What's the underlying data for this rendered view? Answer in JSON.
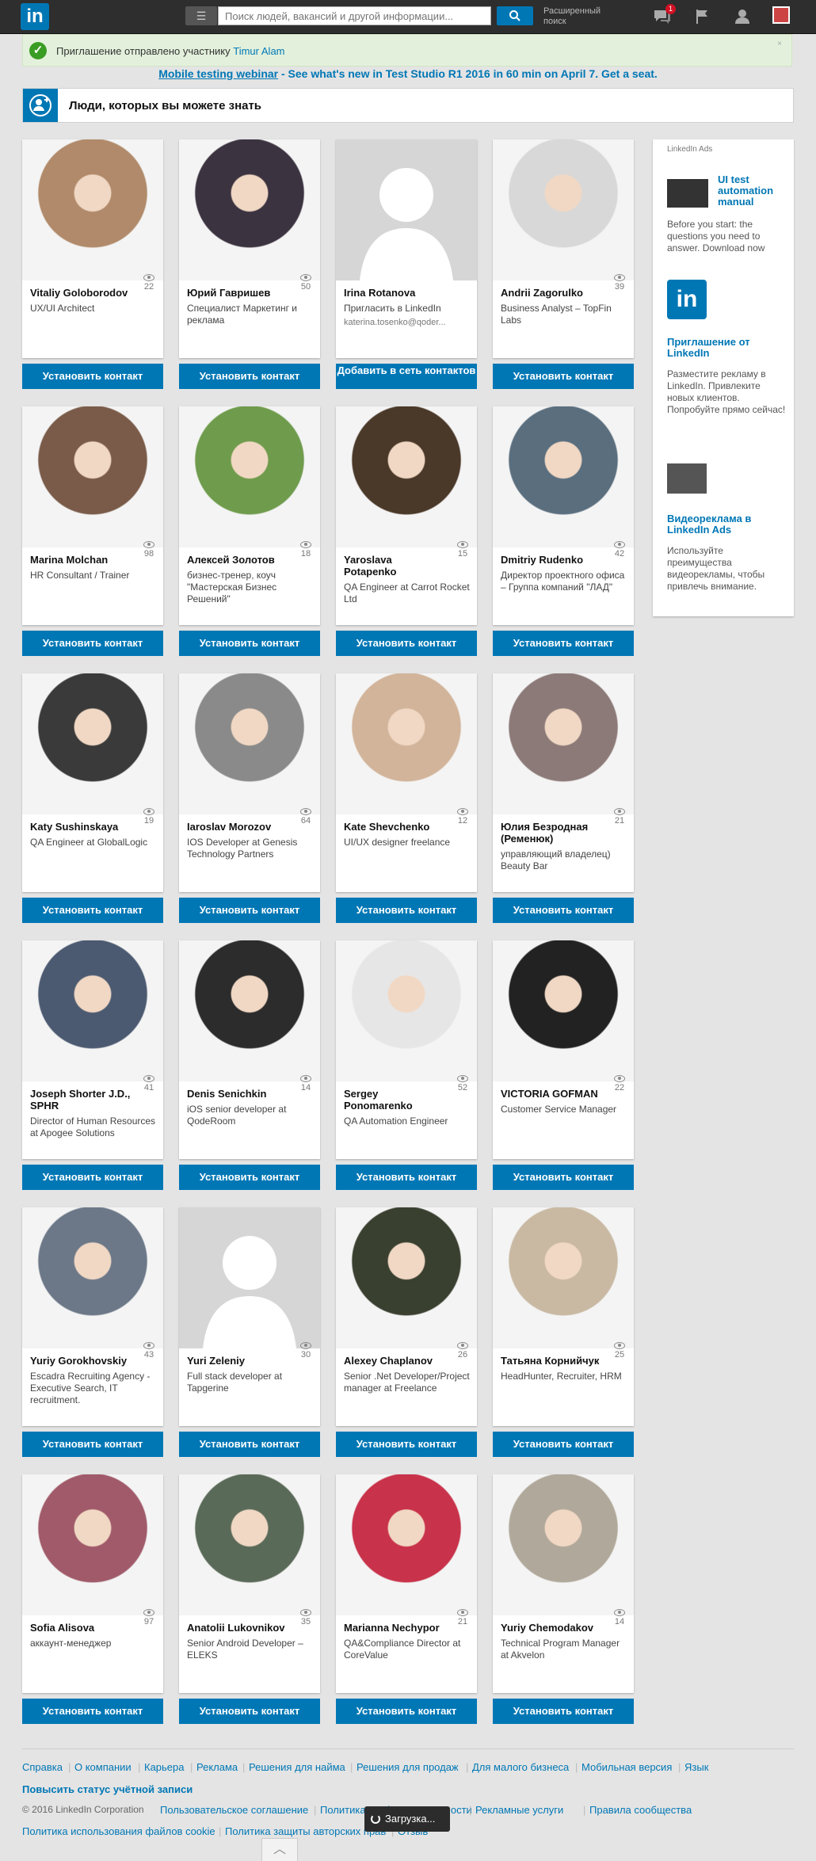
{
  "topbar": {
    "logo": "in",
    "search_placeholder": "Поиск людей, вакансий и другой информации...",
    "advanced_search": "Расширенный поиск",
    "messages_badge": "1"
  },
  "notice": {
    "text": "Приглашение отправлено участнику",
    "name": "Timur Alam",
    "close": "×"
  },
  "webinar": {
    "strong": "Mobile testing webinar",
    "rest": " - See what's new in Test Studio R1 2016 in 60 min on April 7. Get a seat."
  },
  "pymk": {
    "title": "Люди, которых вы можете знать"
  },
  "people": [
    {
      "name": "Vitaliy Goloborodov",
      "title": "UX/UI Architect",
      "count": "22",
      "button": "Установить контакт",
      "photo": "#b08a6a"
    },
    {
      "name": "Юрий Гавришев",
      "title": "Специалист Маркетинг и реклама",
      "count": "50",
      "button": "Установить контакт",
      "photo": "#3b3340"
    },
    {
      "name": "Irina Rotanova",
      "title": "Пригласить в LinkedIn",
      "subtitle": "katerina.tosenko@qoder...",
      "count": "",
      "button": "Добавить в сеть контактов",
      "photo": "placeholder"
    },
    {
      "name": "Andrii Zagorulko",
      "title": "Business Analyst – TopFin Labs",
      "count": "39",
      "button": "Установить контакт",
      "photo": "#d8d8d8"
    },
    {
      "name": "Marina Molchan",
      "title": "HR Consultant / Trainer",
      "count": "98",
      "button": "Установить контакт",
      "photo": "#7a5b49"
    },
    {
      "name": "Алексей Золотов",
      "title": "бизнес-тренер, коуч \"Мастерская Бизнес Решений\"",
      "count": "18",
      "button": "Установить контакт",
      "photo": "#6f9b4c"
    },
    {
      "name": "Yaroslava Potapenko",
      "title": "QA Engineer at Carrot Rocket Ltd",
      "count": "15",
      "button": "Установить контакт",
      "photo": "#4a3828"
    },
    {
      "name": "Dmitriy Rudenko",
      "title": "Директор проектного офиса – Группа компаний \"ЛАД\"",
      "count": "42",
      "button": "Установить контакт",
      "photo": "#5a6e7e"
    },
    {
      "name": "Katy Sushinskaya",
      "title": "QA Engineer at GlobalLogic",
      "count": "19",
      "button": "Установить контакт",
      "photo": "#3a3a3a"
    },
    {
      "name": "Iaroslav Morozov",
      "title": "IOS Developer at Genesis Technology Partners",
      "count": "64",
      "button": "Установить контакт",
      "photo": "#8a8a8a"
    },
    {
      "name": "Kate Shevchenko",
      "title": "UI/UX designer freelance",
      "count": "12",
      "button": "Установить контакт",
      "photo": "#d2b49a"
    },
    {
      "name": "Юлия Безродная (Ременюк)",
      "title": "управляющий владелец) Beauty Bar",
      "count": "21",
      "button": "Установить контакт",
      "photo": "#8c7a78"
    },
    {
      "name": "Joseph Shorter J.D., SPHR",
      "title": "Director of Human Resources at Apogee Solutions",
      "count": "41",
      "button": "Установить контакт",
      "photo": "#4b5a70"
    },
    {
      "name": "Denis Senichkin",
      "title": "iOS senior developer at QodeRoom",
      "count": "14",
      "button": "Установить контакт",
      "photo": "#2c2c2c"
    },
    {
      "name": "Sergey Ponomarenko",
      "title": "QA Automation Engineer",
      "count": "52",
      "button": "Установить контакт",
      "photo": "#e6e6e6"
    },
    {
      "name": "VICTORIA GOFMAN",
      "title": "Customer Service Manager",
      "count": "22",
      "button": "Установить контакт",
      "photo": "#222222"
    },
    {
      "name": "Yuriy Gorokhovskiy",
      "title": "Escadra Recruiting Agency - Executive Search, IT recruitment.",
      "count": "43",
      "button": "Установить контакт",
      "photo": "#6c7888"
    },
    {
      "name": "Yuri Zeleniy",
      "title": "Full stack developer at Tapgerine",
      "count": "30",
      "button": "Установить контакт",
      "photo": "placeholder"
    },
    {
      "name": "Alexey Chaplanov",
      "title": "Senior .Net Developer/Project manager at Freelance",
      "count": "26",
      "button": "Установить контакт",
      "photo": "#3a4030"
    },
    {
      "name": "Татьяна Корнийчук",
      "title": "HeadHunter, Recruiter, HRM",
      "count": "25",
      "button": "Установить контакт",
      "photo": "#c9b9a3"
    },
    {
      "name": "Sofia Alisova",
      "title": "аккаунт-менеджер",
      "count": "97",
      "button": "Установить контакт",
      "photo": "#a05a6a"
    },
    {
      "name": "Anatolii Lukovnikov",
      "title": "Senior Android Developer – ELEKS",
      "count": "35",
      "button": "Установить контакт",
      "photo": "#5a6a58"
    },
    {
      "name": "Marianna Nechypor",
      "title": "QA&Compliance Director at CoreValue",
      "count": "21",
      "button": "Установить контакт",
      "photo": "#c8324a"
    },
    {
      "name": "Yuriy Chemodakov",
      "title": "Technical Program Manager at Akvelon",
      "count": "14",
      "button": "Установить контакт",
      "photo": "#b0a89a"
    }
  ],
  "ads": {
    "header": "LinkedIn Ads",
    "items": [
      {
        "title": "UI test automation manual",
        "body": "Before you start: the questions you need to answer. Download now"
      },
      {
        "title": "Приглашение от LinkedIn",
        "body": "Разместите рекламу в LinkedIn. Привлеките новых клиентов. Попробуйте прямо сейчас!"
      },
      {
        "title": "Видеореклама в LinkedIn Ads",
        "body": "Используйте преимущества видеорекламы, чтобы привлечь внимание."
      }
    ]
  },
  "footer": {
    "row1": [
      "Справка",
      "О компании",
      "Карьера",
      "Реклама",
      "Решения для найма",
      "Решения для продаж",
      "Для малого бизнеса",
      "Мобильная версия",
      "Язык"
    ],
    "upgrade": "Повысить статус учётной записи",
    "copyright": "© 2016 LinkedIn Corporation",
    "row2": [
      "Пользовательское соглашение",
      "Политика конфиденциальности",
      "Рекламные услуги",
      "Правила сообщества"
    ],
    "row3": [
      "Политика использования файлов cookie",
      "Политика защиты авторских прав",
      "Отзыв"
    ],
    "loading": "Загрузка..."
  }
}
